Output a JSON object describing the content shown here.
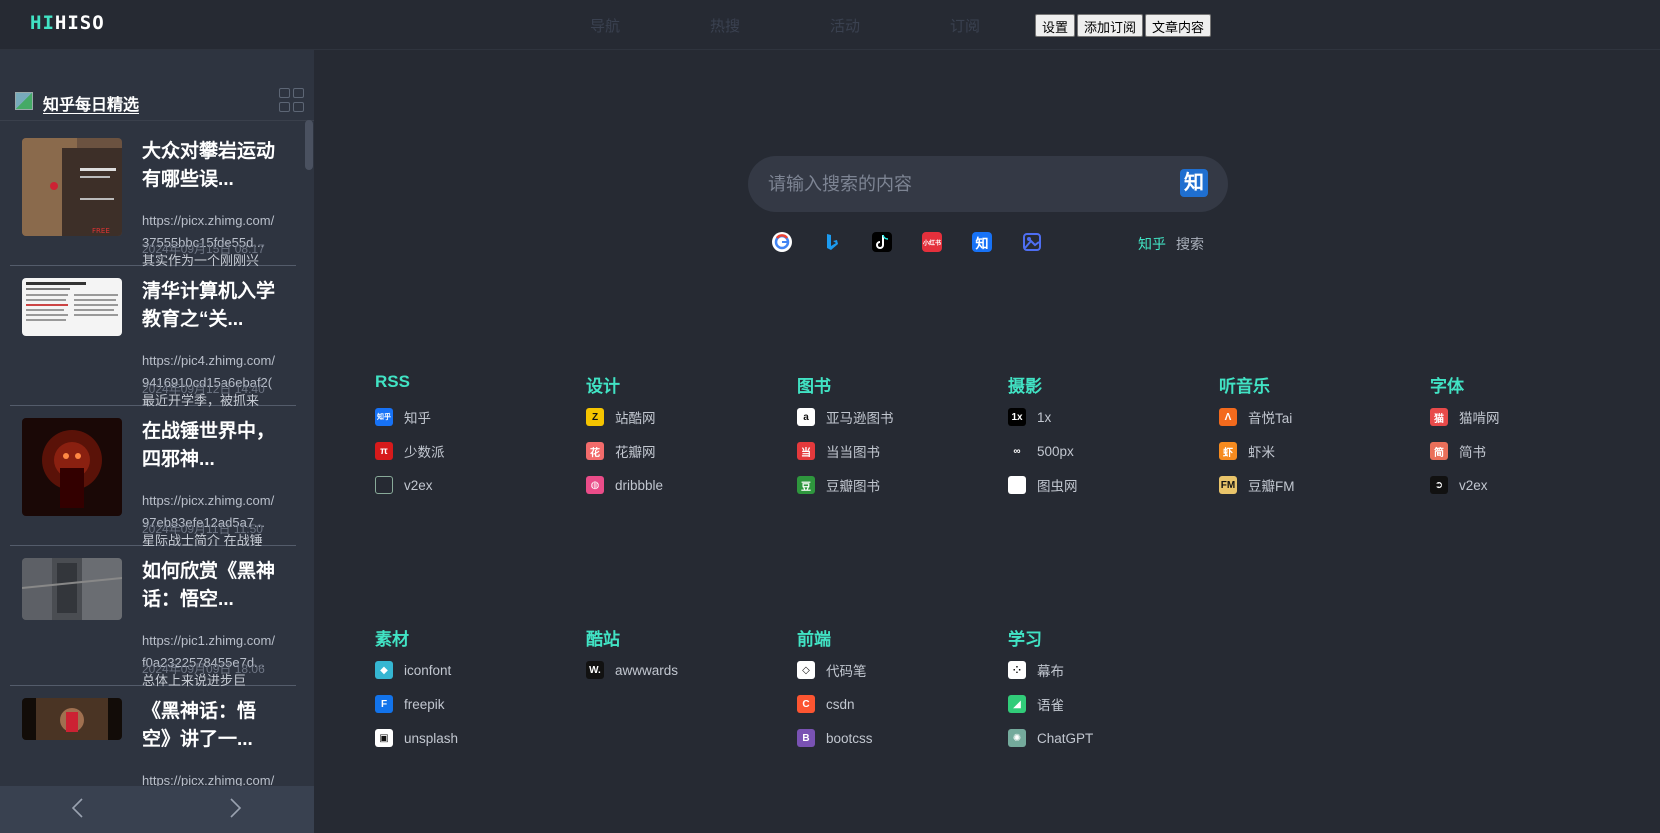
{
  "app": {
    "logo_accent": "HI",
    "logo_rest": "HISO"
  },
  "nav": [
    "导航",
    "热搜",
    "活动",
    "订阅"
  ],
  "top_buttons": {
    "settings": "设置",
    "add_subscription": "添加订阅",
    "article_content": "文章内容"
  },
  "sidebar": {
    "title": "知乎每日精选",
    "items": [
      {
        "title": "大众对攀岩运动有哪些误...",
        "url1": "https://picx.zhimg.com/",
        "url2": "37555bbc15fde55d...",
        "date": "2024年09月15日 08:17",
        "summary": "其实作为一个刚刚兴"
      },
      {
        "title": "清华计算机入学教育之“关...",
        "url1": "https://pic4.zhimg.com/",
        "url2": "9416910cd15a6ebaf2(",
        "date": "2024年09月12日 14:40",
        "summary": "最近开学季，被抓来"
      },
      {
        "title": "在战锤世界中，四邪神...",
        "url1": "https://picx.zhimg.com/",
        "url2": "97eb83efe12ad5a7...",
        "date": "2024年09月11日 11:50",
        "summary": "星际战士简介 在战锤"
      },
      {
        "title": "如何欣赏《黑神话：悟空...",
        "url1": "https://pic1.zhimg.com/",
        "url2": "f0a2322578455e7d...",
        "date": "2024年09月09日 18:06",
        "summary": "总体上来说进步巨"
      },
      {
        "title": "《黑神话：悟空》讲了一...",
        "url1": "https://picx.zhimg.com/",
        "url2": "",
        "date": "",
        "summary": ""
      }
    ]
  },
  "search": {
    "placeholder": "请输入搜索的内容",
    "button_label": "知",
    "engine_label": "知乎",
    "search_word": "搜索"
  },
  "sections": [
    {
      "title": "RSS",
      "links": [
        {
          "label": "知乎",
          "icon": "zhihu-icon",
          "color": "#1772f6"
        },
        {
          "label": "少数派",
          "icon": "sspai-icon",
          "color": "#d71a1b"
        },
        {
          "label": "v2ex",
          "icon": "broken-image-icon",
          "color": "#6b8"
        }
      ]
    },
    {
      "title": "设计",
      "links": [
        {
          "label": "站酷网",
          "icon": "zcool-icon",
          "color": "#f5c400"
        },
        {
          "label": "花瓣网",
          "icon": "huaban-icon",
          "color": "#f26b6b"
        },
        {
          "label": "dribbble",
          "icon": "dribbble-icon",
          "color": "#ea4c89"
        }
      ]
    },
    {
      "title": "图书",
      "links": [
        {
          "label": "亚马逊图书",
          "icon": "amazon-icon",
          "color": "#ffffff"
        },
        {
          "label": "当当图书",
          "icon": "dangdang-icon",
          "color": "#e4393c"
        },
        {
          "label": "豆瓣图书",
          "icon": "douban-icon",
          "color": "#2e963d"
        }
      ]
    },
    {
      "title": "摄影",
      "links": [
        {
          "label": "1x",
          "icon": "1x-icon",
          "color": "#000000"
        },
        {
          "label": "500px",
          "icon": "500px-icon",
          "color": "#262a33"
        },
        {
          "label": "图虫网",
          "icon": "tuchong-icon",
          "color": "#ffffff"
        }
      ]
    },
    {
      "title": "听音乐",
      "links": [
        {
          "label": "音悦Tai",
          "icon": "yinyuetai-icon",
          "color": "#f36a1d"
        },
        {
          "label": "虾米",
          "icon": "xiami-icon",
          "color": "#f68b1f"
        },
        {
          "label": "豆瓣FM",
          "icon": "doubanfm-icon",
          "color": "#e9c46a"
        }
      ]
    },
    {
      "title": "字体",
      "links": [
        {
          "label": "猫啃网",
          "icon": "maoken-icon",
          "color": "#e84a4a"
        },
        {
          "label": "简书",
          "icon": "jianshu-icon",
          "color": "#ea6f5a"
        },
        {
          "label": "v2ex",
          "icon": "v2ex-icon",
          "color": "#111111"
        }
      ]
    },
    {
      "title": "素材",
      "links": [
        {
          "label": "iconfont",
          "icon": "iconfont-icon",
          "color": "#35b6d2"
        },
        {
          "label": "freepik",
          "icon": "freepik-icon",
          "color": "#1273eb"
        },
        {
          "label": "unsplash",
          "icon": "unsplash-icon",
          "color": "#ffffff"
        }
      ]
    },
    {
      "title": "酷站",
      "links": [
        {
          "label": "awwwards",
          "icon": "awwwards-icon",
          "color": "#111111"
        }
      ]
    },
    {
      "title": "前端",
      "links": [
        {
          "label": "代码笔",
          "icon": "codepen-icon",
          "color": "#ffffff"
        },
        {
          "label": "csdn",
          "icon": "csdn-icon",
          "color": "#fc5531"
        },
        {
          "label": "bootcss",
          "icon": "bootstrap-icon",
          "color": "#7952b3"
        }
      ]
    },
    {
      "title": "学习",
      "links": [
        {
          "label": "幕布",
          "icon": "mubu-icon",
          "color": "#ffffff"
        },
        {
          "label": "语雀",
          "icon": "yuque-icon",
          "color": "#31cc79"
        },
        {
          "label": "ChatGPT",
          "icon": "chatgpt-icon",
          "color": "#74aa9c"
        }
      ]
    }
  ],
  "icon_glyphs": {
    "zhihu": "知乎",
    "sspai": "π",
    "zcool": "Z",
    "huaban": "花",
    "dribbble": "◍",
    "amazon": "a",
    "dangdang": "当",
    "douban": "豆",
    "1x": "1x",
    "500px": "∞",
    "yinyuetai": "Λ",
    "xiami": "虾",
    "doubanfm": "FM",
    "maoken": "猫",
    "jianshu": "简",
    "v2ex": "➲",
    "iconfont": "◆",
    "freepik": "F",
    "unsplash": "▣",
    "awwwards": "W.",
    "codepen": "◇",
    "csdn": "C",
    "bootstrap": "B",
    "mubu": "⁘",
    "yuque": "◢",
    "chatgpt": "✺"
  }
}
